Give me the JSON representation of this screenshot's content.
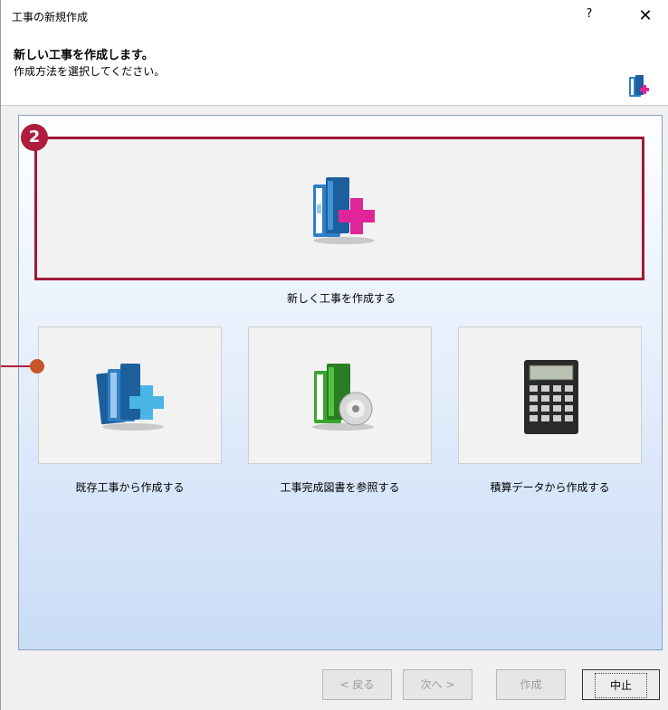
{
  "window": {
    "title": "工事の新規作成",
    "help": "?",
    "close": "✕"
  },
  "header": {
    "title": "新しい工事を作成します。",
    "subtitle": "作成方法を選択してください。"
  },
  "options": {
    "main_label": "新しく工事を作成する",
    "existing_label": "既存工事から作成する",
    "reference_label": "工事完成図書を参照する",
    "estimate_label": "積算データから作成する"
  },
  "annotation": {
    "step_number": "2"
  },
  "buttons": {
    "back": "< 戻る",
    "next": "次へ >",
    "create": "作成",
    "cancel": "中止"
  },
  "colors": {
    "accent": "#a01838",
    "panel_top": "#ffffff",
    "panel_bottom": "#c9dcf6",
    "book_blue": "#2f7fc4",
    "plus_magenta": "#e0259a",
    "plus_cyan": "#4ab6e8",
    "book_green": "#3aa52e"
  },
  "icons": {
    "header": "book-plus-icon",
    "main": "book-plus-icon",
    "existing": "book-copy-plus-icon",
    "reference": "book-disc-icon",
    "estimate": "calculator-icon"
  }
}
